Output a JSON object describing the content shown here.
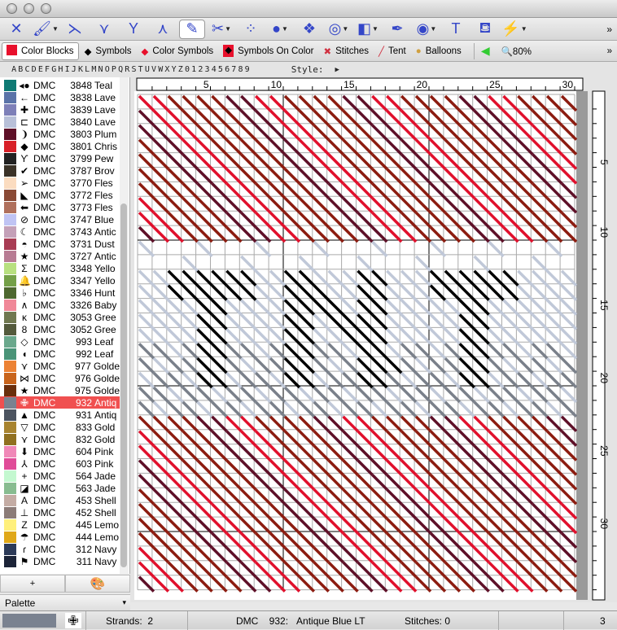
{
  "window": {
    "buttons": [
      "close",
      "minimize",
      "zoom"
    ]
  },
  "toolbar": {
    "tools": [
      {
        "icon": "full-cross-stitch-icon",
        "glyph": "✕",
        "dropdown": false
      },
      {
        "icon": "paintbrush-icon",
        "glyph": "🖌",
        "dropdown": true
      },
      {
        "icon": "half-stitch-icon",
        "glyph": "⋋",
        "dropdown": false
      },
      {
        "icon": "three-quarter-stitch-icon",
        "glyph": "⋎",
        "dropdown": false
      },
      {
        "icon": "quarter-stitch-icon",
        "glyph": "Y",
        "dropdown": false
      },
      {
        "icon": "petite-stitch-icon",
        "glyph": "⋏",
        "dropdown": false
      },
      {
        "icon": "backstitch-pencil-icon",
        "glyph": "✎",
        "dropdown": false,
        "selected": true
      },
      {
        "icon": "specialty-stitch-icon",
        "glyph": "✂",
        "dropdown": true
      },
      {
        "icon": "color-swap-icon",
        "glyph": "⁘",
        "dropdown": false
      },
      {
        "icon": "bead-icon",
        "glyph": "●",
        "dropdown": true
      },
      {
        "icon": "button-icon",
        "glyph": "❖",
        "dropdown": false
      },
      {
        "icon": "concentric-circle-icon",
        "glyph": "◎",
        "dropdown": true
      },
      {
        "icon": "shapes-icon",
        "glyph": "◧",
        "dropdown": true
      },
      {
        "icon": "pen-nib-icon",
        "glyph": "✒",
        "dropdown": false
      },
      {
        "icon": "eye-icon",
        "glyph": "◉",
        "dropdown": true
      },
      {
        "icon": "text-icon",
        "glyph": "T",
        "dropdown": false
      },
      {
        "icon": "paint-bucket-icon",
        "glyph": "⛾",
        "dropdown": false
      },
      {
        "icon": "magic-wand-icon",
        "glyph": "⚡",
        "dropdown": true
      }
    ],
    "overflow": "»"
  },
  "viewbar": {
    "items": [
      {
        "label": "Color Blocks",
        "icon": "color-blocks-icon",
        "selected": true
      },
      {
        "label": "Symbols",
        "icon": "symbols-icon"
      },
      {
        "label": "Color Symbols",
        "icon": "color-symbols-icon"
      },
      {
        "label": "Symbols On Color",
        "icon": "symbols-on-color-icon"
      },
      {
        "label": "Stitches",
        "icon": "stitches-icon"
      },
      {
        "label": "Tent",
        "icon": "tent-icon"
      },
      {
        "label": "Balloons",
        "icon": "balloons-icon"
      }
    ],
    "zoom": "80%",
    "overflow": "»"
  },
  "alphabet": {
    "chars": [
      "A",
      "B",
      "C",
      "D",
      "E",
      "F",
      "G",
      "H",
      "I",
      "J",
      "K",
      "L",
      "M",
      "N",
      "O",
      "P",
      "Q",
      "R",
      "S",
      "T",
      "U",
      "V",
      "W",
      "X",
      "Y",
      "Z",
      "0",
      "1",
      "2",
      "3",
      "4",
      "5",
      "6",
      "7",
      "8",
      "9"
    ],
    "style_label": "Style:",
    "style_arrow": "▶"
  },
  "palette_list": [
    {
      "brand": "DMC",
      "num": "3848",
      "name": "Teal",
      "color": "#0f7a74",
      "sym": "◂●"
    },
    {
      "brand": "DMC",
      "num": "3838",
      "name": "Lave",
      "color": "#5a73a8",
      "sym": "←"
    },
    {
      "brand": "DMC",
      "num": "3839",
      "name": "Lave",
      "color": "#7e80b8",
      "sym": "✚"
    },
    {
      "brand": "DMC",
      "num": "3840",
      "name": "Lave",
      "color": "#b8c0d8",
      "sym": "⊏"
    },
    {
      "brand": "DMC",
      "num": "3803",
      "name": "Plum",
      "color": "#5e1028",
      "sym": "❩"
    },
    {
      "brand": "DMC",
      "num": "3801",
      "name": "Chris",
      "color": "#d82028",
      "sym": "◆"
    },
    {
      "brand": "DMC",
      "num": "3799",
      "name": "Pew",
      "color": "#222222",
      "sym": "ϒ"
    },
    {
      "brand": "DMC",
      "num": "3787",
      "name": "Brov",
      "color": "#3b3328",
      "sym": "✔"
    },
    {
      "brand": "DMC",
      "num": "3770",
      "name": "Fles",
      "color": "#fbdcc0",
      "sym": "➢"
    },
    {
      "brand": "DMC",
      "num": "3772",
      "name": "Fles",
      "color": "#8a4a36",
      "sym": "◣"
    },
    {
      "brand": "DMC",
      "num": "3773",
      "name": "Fles",
      "color": "#b0705c",
      "sym": "⬅"
    },
    {
      "brand": "DMC",
      "num": "3747",
      "name": "Blue",
      "color": "#c0c4f4",
      "sym": "⊘"
    },
    {
      "brand": "DMC",
      "num": "3743",
      "name": "Antic",
      "color": "#c4a0b8",
      "sym": "☾"
    },
    {
      "brand": "DMC",
      "num": "3731",
      "name": "Dust",
      "color": "#a83c54",
      "sym": "◓"
    },
    {
      "brand": "DMC",
      "num": "3727",
      "name": "Antic",
      "color": "#b87c94",
      "sym": "★"
    },
    {
      "brand": "DMC",
      "num": "3348",
      "name": "Yello",
      "color": "#b8e080",
      "sym": "Σ"
    },
    {
      "brand": "DMC",
      "num": "3347",
      "name": "Yello",
      "color": "#74a048",
      "sym": "🔔"
    },
    {
      "brand": "DMC",
      "num": "3346",
      "name": "Hunt",
      "color": "#4e6830",
      "sym": "♭"
    },
    {
      "brand": "DMC",
      "num": "3326",
      "name": "Baby",
      "color": "#f08898",
      "sym": "∧"
    },
    {
      "brand": "DMC",
      "num": "3053",
      "name": "Gree",
      "color": "#707850",
      "sym": "κ"
    },
    {
      "brand": "DMC",
      "num": "3052",
      "name": "Gree",
      "color": "#545a3c",
      "sym": "8"
    },
    {
      "brand": "DMC",
      "num": "993",
      "name": "Leaf",
      "color": "#6aa88c",
      "sym": "◇"
    },
    {
      "brand": "DMC",
      "num": "992",
      "name": "Leaf",
      "color": "#4a9478",
      "sym": "◖"
    },
    {
      "brand": "DMC",
      "num": "977",
      "name": "Golde",
      "color": "#ec8234",
      "sym": "⋎"
    },
    {
      "brand": "DMC",
      "num": "976",
      "name": "Golde",
      "color": "#c8641c",
      "sym": "⋈"
    },
    {
      "brand": "DMC",
      "num": "975",
      "name": "Golde",
      "color": "#6a2e0c",
      "sym": "★"
    },
    {
      "brand": "DMC",
      "num": "932",
      "name": "Antiq",
      "color": "#7a8290",
      "sym": "✙",
      "selected": true
    },
    {
      "brand": "DMC",
      "num": "931",
      "name": "Antiq",
      "color": "#4c5460",
      "sym": "▲"
    },
    {
      "brand": "DMC",
      "num": "833",
      "name": "Gold",
      "color": "#a88430",
      "sym": "▽"
    },
    {
      "brand": "DMC",
      "num": "832",
      "name": "Gold",
      "color": "#907020",
      "sym": "⋎"
    },
    {
      "brand": "DMC",
      "num": "604",
      "name": "Pink",
      "color": "#f088b8",
      "sym": "⬇"
    },
    {
      "brand": "DMC",
      "num": "603",
      "name": "Pink",
      "color": "#e04c98",
      "sym": "⅄"
    },
    {
      "brand": "DMC",
      "num": "564",
      "name": "Jade",
      "color": "#c4f8d0",
      "sym": "+"
    },
    {
      "brand": "DMC",
      "num": "563",
      "name": "Jade",
      "color": "#88bc90",
      "sym": "◪"
    },
    {
      "brand": "DMC",
      "num": "453",
      "name": "Shell",
      "color": "#c4aca4",
      "sym": "A"
    },
    {
      "brand": "DMC",
      "num": "452",
      "name": "Shell",
      "color": "#8c7c78",
      "sym": "⊥"
    },
    {
      "brand": "DMC",
      "num": "445",
      "name": "Lemo",
      "color": "#fff07c",
      "sym": "Z"
    },
    {
      "brand": "DMC",
      "num": "444",
      "name": "Lemo",
      "color": "#e0a818",
      "sym": "☂"
    },
    {
      "brand": "DMC",
      "num": "312",
      "name": "Navy",
      "color": "#2c3a58",
      "sym": "ɾ"
    },
    {
      "brand": "DMC",
      "num": "311",
      "name": "Navy",
      "color": "#1c2438",
      "sym": "⚑"
    }
  ],
  "left_buttons": {
    "add": "+",
    "palette_icon": "palette-icon"
  },
  "palette_select": {
    "value": "Palette",
    "arrow": "▾"
  },
  "ruler": {
    "top_labels": [
      "5",
      "10",
      "15",
      "20",
      "25",
      "30"
    ],
    "side_labels": [
      "5",
      "10",
      "15",
      "20",
      "25",
      "30"
    ]
  },
  "stitch_colors": {
    "red": "#e0102c",
    "dark_red": "#8c1c10",
    "plum": "#5e1028",
    "light": "#c0c8d8",
    "grey": "#7a808a",
    "black": "#000000"
  },
  "status": {
    "current_color": "#7a8290",
    "strands_label": "Strands:",
    "strands": "2",
    "brand": "DMC",
    "num": "932:",
    "name": "Antique Blue LT",
    "stitches_label": "Stitches:",
    "stitches": "0",
    "page": "3"
  }
}
